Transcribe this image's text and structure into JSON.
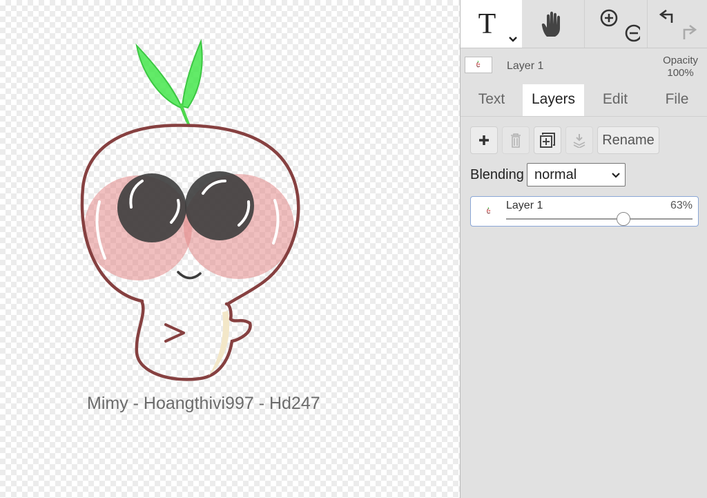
{
  "canvas": {
    "caption": "Mimy - Hoangthivi997 - Hd247"
  },
  "toolbar": {
    "tools": [
      {
        "name": "text-tool",
        "icon": "T",
        "active": true
      },
      {
        "name": "hand-tool",
        "icon": "hand-icon",
        "active": false
      },
      {
        "name": "zoom-tools",
        "icon": "zoom-in-out-icon",
        "active": false
      },
      {
        "name": "history-tools",
        "icon": "undo-redo-icon",
        "active": false
      }
    ]
  },
  "layer_bar": {
    "layer_name": "Layer 1",
    "opacity_label": "Opacity",
    "opacity_value": "100%"
  },
  "tabs": [
    {
      "label": "Text",
      "active": false
    },
    {
      "label": "Layers",
      "active": true
    },
    {
      "label": "Edit",
      "active": false
    },
    {
      "label": "File",
      "active": false
    }
  ],
  "layers_panel": {
    "buttons": [
      {
        "icon": "plus-icon",
        "disabled": false
      },
      {
        "icon": "trash-icon",
        "disabled": true
      },
      {
        "icon": "duplicate-icon",
        "disabled": false
      },
      {
        "icon": "merge-down-icon",
        "disabled": true
      }
    ],
    "rename_label": "Rename",
    "blending_label": "Blending",
    "blending_value": "normal",
    "layers": [
      {
        "name": "Layer 1",
        "opacity_text": "63%",
        "opacity": 0.63
      }
    ]
  },
  "colors": {
    "panel_bg": "#e1e1e1",
    "accent_border": "#8aa6d6"
  }
}
